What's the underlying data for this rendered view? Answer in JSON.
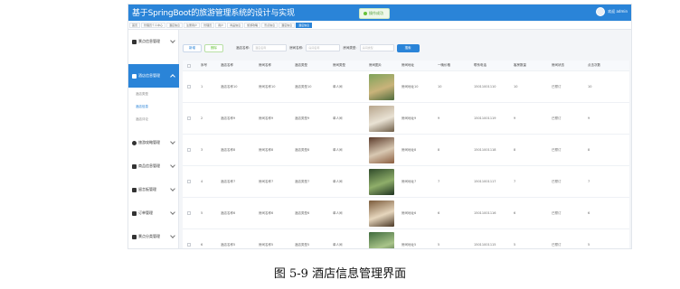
{
  "app": {
    "title": "基于SpringBoot的旅游管理系统的设计与实现",
    "toast": "操作成功",
    "user": "欢迎 admin"
  },
  "tabs": [
    "首页",
    "管理员个人中心",
    "酒店信息",
    "注册用户",
    "管理员",
    "用户",
    "商品信息",
    "旅游攻略",
    "景点信息",
    "酒店信息",
    "酒店信息"
  ],
  "sidebar": {
    "menus": [
      {
        "label": "景点信息管理"
      },
      {
        "label": "酒店信息管理"
      },
      {
        "label": "旅游攻略管理"
      },
      {
        "label": "商品信息管理"
      },
      {
        "label": "留言板管理"
      },
      {
        "label": "订单管理"
      },
      {
        "label": "景点分类管理"
      }
    ],
    "submenus": [
      "酒店类型",
      "酒店信息",
      "酒店评论"
    ]
  },
  "toolbar": {
    "add_label": "新增",
    "delete_label": "删除",
    "name_label": "酒店名称:",
    "name_placeholder": "酒店名称",
    "room_name_label": "房间名称:",
    "room_name_placeholder": "房间名称",
    "room_type_label": "房间类型:",
    "room_type_placeholder": "房间类型",
    "search_label": "搜索"
  },
  "table": {
    "columns": [
      "序号",
      "酒店名称",
      "房间名称",
      "酒店类型",
      "房间类型",
      "房间图片",
      "房间地址",
      "一晚价格",
      "联系电话",
      "客房数量",
      "房间状态",
      "点击次数"
    ],
    "rows": [
      {
        "idx": "1",
        "hotel": "酒店名称10",
        "room": "房间名称10",
        "htype": "酒店类型10",
        "rtype": "单人间",
        "addr": "房间地址10",
        "price": "10",
        "phone": "15011001110",
        "count": "10",
        "status": "已预订",
        "clicks": "10"
      },
      {
        "idx": "2",
        "hotel": "酒店名称9",
        "room": "房间名称9",
        "htype": "酒店类型9",
        "rtype": "单人间",
        "addr": "房间地址9",
        "price": "9",
        "phone": "15011001119",
        "count": "9",
        "status": "已预订",
        "clicks": "9"
      },
      {
        "idx": "3",
        "hotel": "酒店名称8",
        "room": "房间名称8",
        "htype": "酒店类型8",
        "rtype": "单人间",
        "addr": "房间地址8",
        "price": "8",
        "phone": "15011001118",
        "count": "8",
        "status": "已预订",
        "clicks": "8"
      },
      {
        "idx": "4",
        "hotel": "酒店名称7",
        "room": "房间名称7",
        "htype": "酒店类型7",
        "rtype": "单人间",
        "addr": "房间地址7",
        "price": "7",
        "phone": "15011001117",
        "count": "7",
        "status": "已预订",
        "clicks": "7"
      },
      {
        "idx": "5",
        "hotel": "酒店名称6",
        "room": "房间名称6",
        "htype": "酒店类型6",
        "rtype": "单人间",
        "addr": "房间地址6",
        "price": "6",
        "phone": "15011001116",
        "count": "6",
        "status": "已预订",
        "clicks": "6"
      },
      {
        "idx": "6",
        "hotel": "酒店名称5",
        "room": "房间名称5",
        "htype": "酒店类型5",
        "rtype": "单人间",
        "addr": "房间地址5",
        "price": "5",
        "phone": "15011001115",
        "count": "5",
        "status": "已预订",
        "clicks": "5"
      }
    ]
  },
  "caption": "图 5-9 酒店信息管理界面",
  "colors": {
    "primary": "#2a84d8",
    "success": "#67c23a"
  }
}
